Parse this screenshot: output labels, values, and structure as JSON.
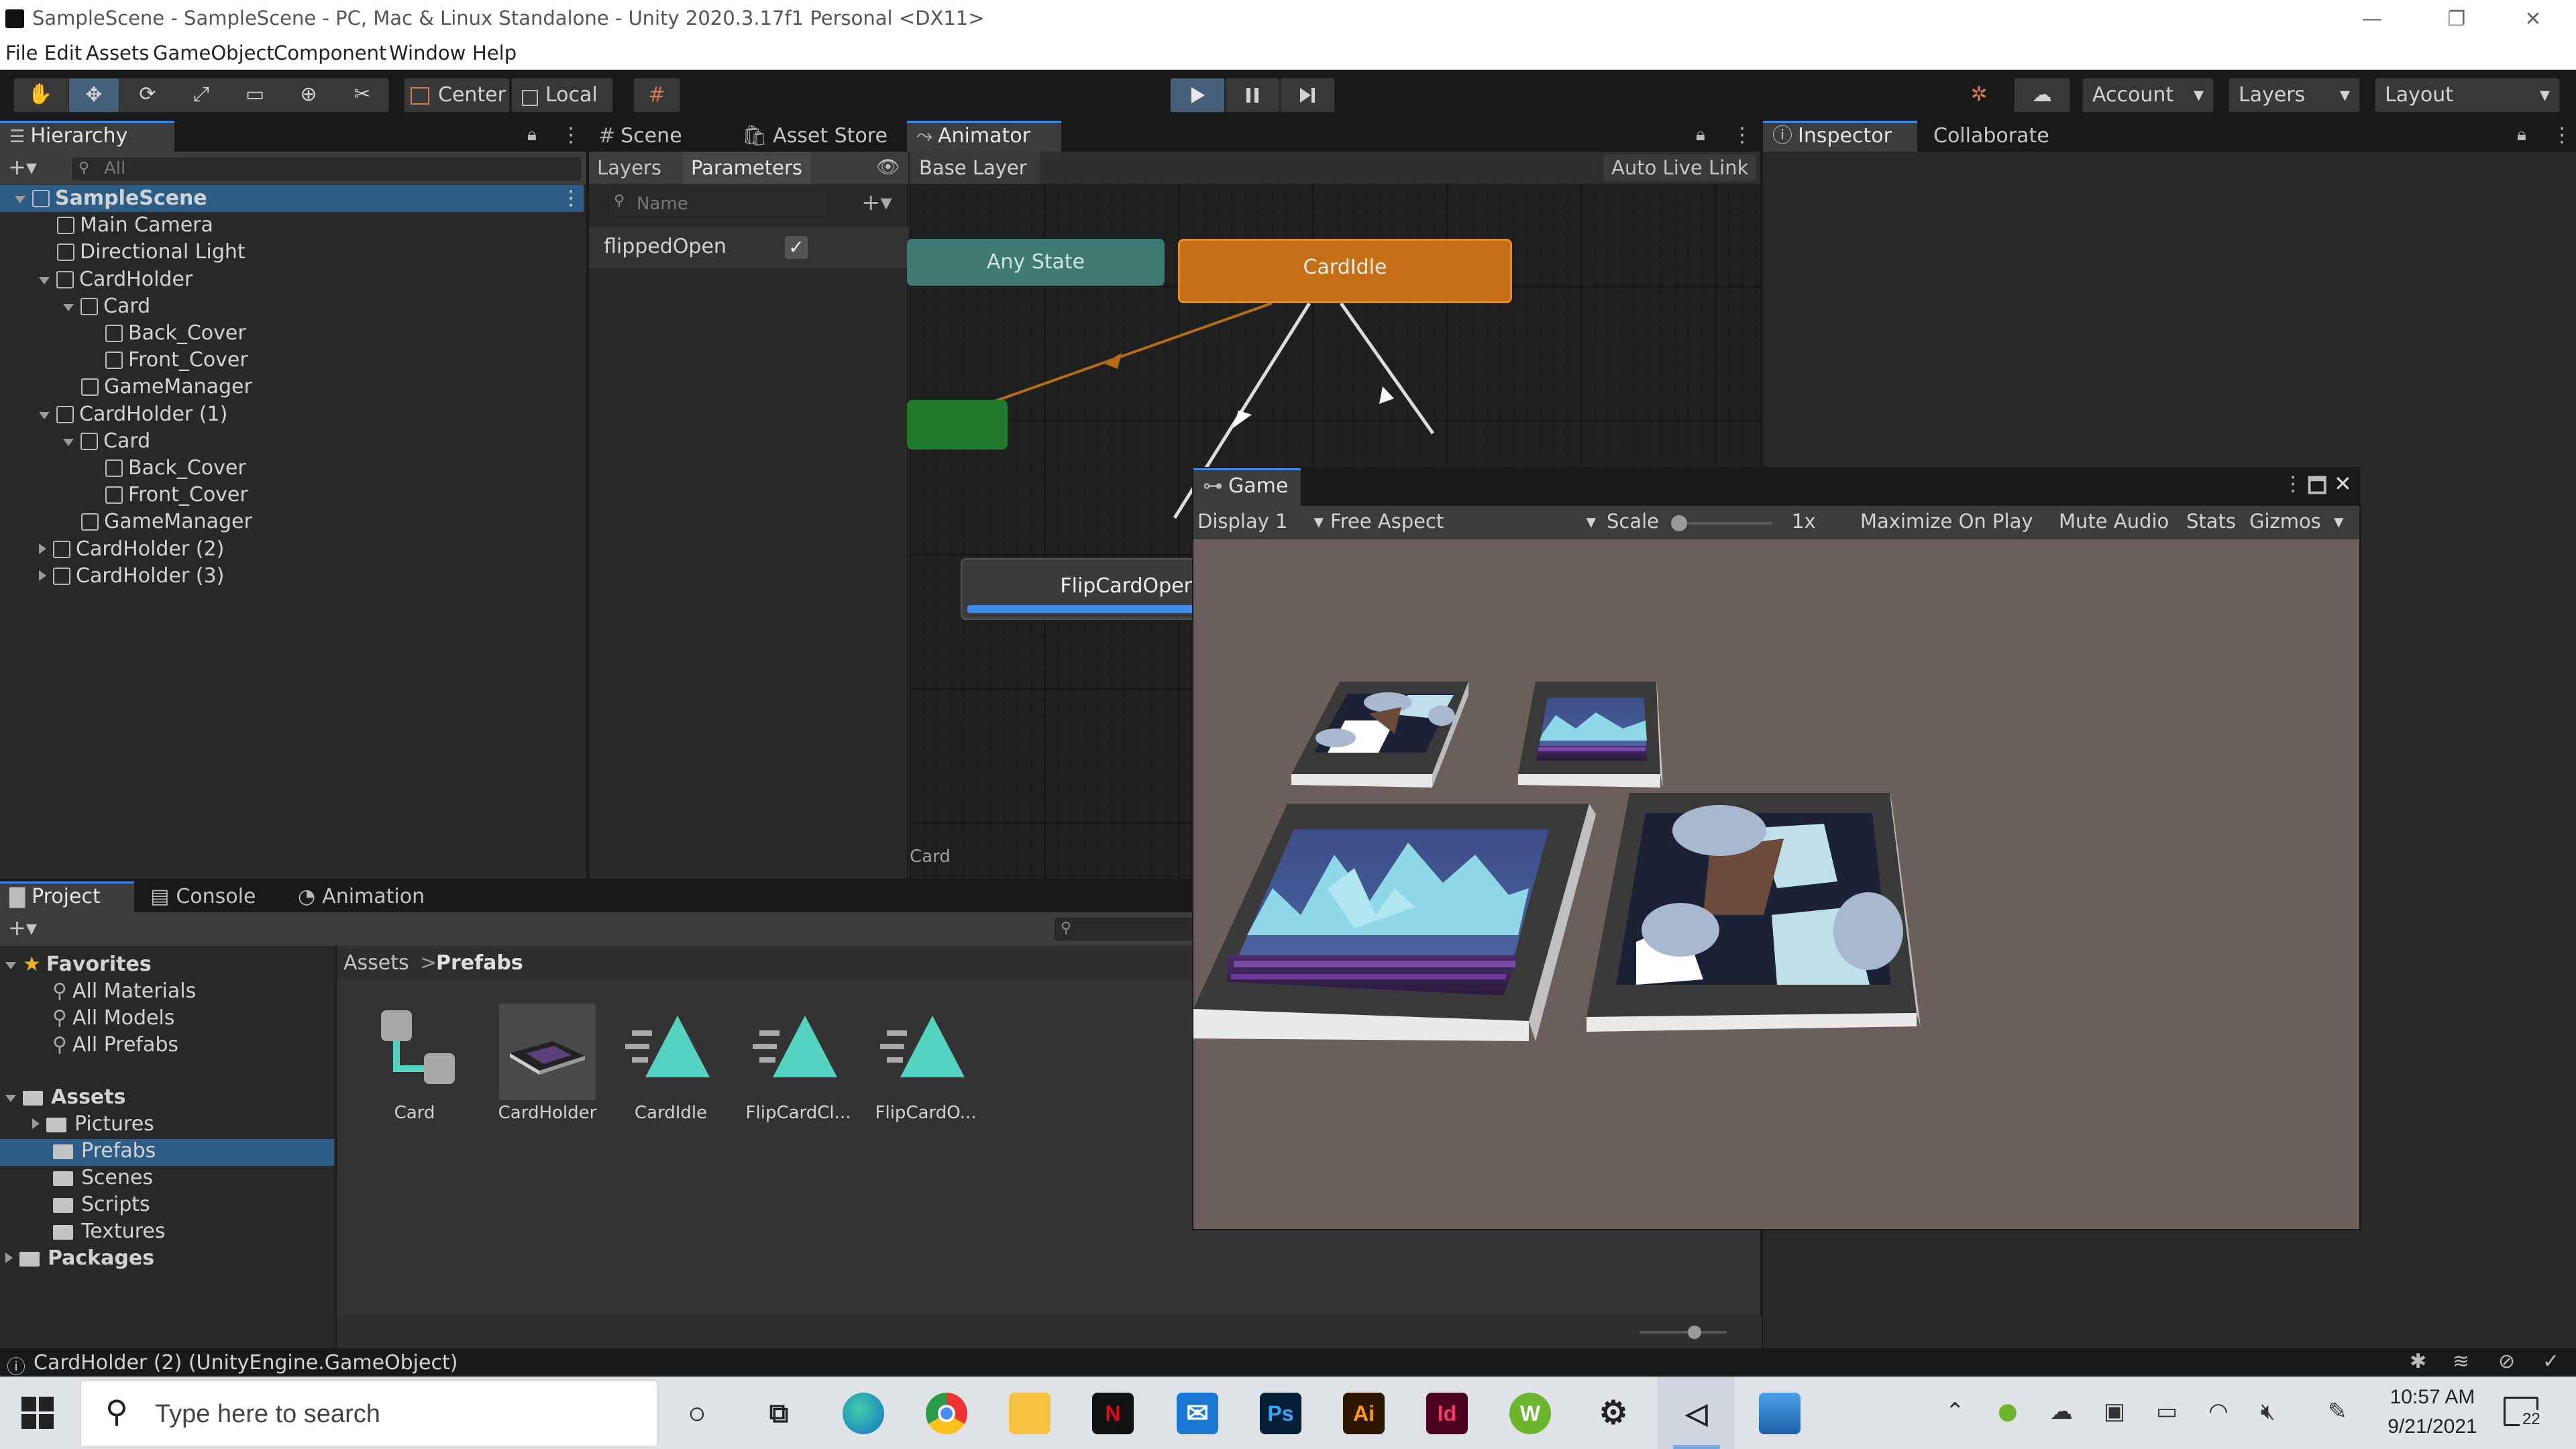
{
  "window": {
    "title": "SampleScene - SampleScene - PC, Mac & Linux Standalone - Unity 2020.3.17f1 Personal <DX11>",
    "minimize": "—",
    "restore": "❐",
    "close": "✕"
  },
  "menu": [
    "File",
    "Edit",
    "Assets",
    "GameObject",
    "Component",
    "Window",
    "Help"
  ],
  "toolbar": {
    "pivot": "Center",
    "space": "Local",
    "account": "Account",
    "layers": "Layers",
    "layout": "Layout",
    "play_icon": "play-icon",
    "pause_icon": "pause-icon",
    "step_icon": "step-icon"
  },
  "hierarchy": {
    "tab": "Hierarchy",
    "search_placeholder": "All",
    "rows": [
      {
        "label": "SampleScene",
        "depth": 0,
        "arrow": "down"
      },
      {
        "label": "Main Camera",
        "depth": 1,
        "arrow": ""
      },
      {
        "label": "Directional Light",
        "depth": 1,
        "arrow": ""
      },
      {
        "label": "CardHolder",
        "depth": 1,
        "arrow": "down"
      },
      {
        "label": "Card",
        "depth": 2,
        "arrow": "down"
      },
      {
        "label": "Back_Cover",
        "depth": 3,
        "arrow": ""
      },
      {
        "label": "Front_Cover",
        "depth": 3,
        "arrow": ""
      },
      {
        "label": "GameManager",
        "depth": 2,
        "arrow": ""
      },
      {
        "label": "CardHolder (1)",
        "depth": 1,
        "arrow": "down"
      },
      {
        "label": "Card",
        "depth": 2,
        "arrow": "down"
      },
      {
        "label": "Back_Cover",
        "depth": 3,
        "arrow": ""
      },
      {
        "label": "Front_Cover",
        "depth": 3,
        "arrow": ""
      },
      {
        "label": "GameManager",
        "depth": 2,
        "arrow": ""
      },
      {
        "label": "CardHolder (2)",
        "depth": 1,
        "arrow": "right"
      },
      {
        "label": "CardHolder (3)",
        "depth": 1,
        "arrow": "right"
      }
    ]
  },
  "center_tabs": {
    "scene": "Scene",
    "asset_store": "Asset Store",
    "animator": "Animator"
  },
  "animator": {
    "layers_tab": "Layers",
    "parameters_tab": "Parameters",
    "base_layer": "Base Layer",
    "auto_live_link": "Auto Live Link",
    "name_placeholder": "Name",
    "parameter_name": "flippedOpen",
    "parameter_checked": true,
    "any_state": "Any State",
    "card_idle": "CardIdle",
    "flip_card_open": "FlipCardOpen",
    "footer": "Card"
  },
  "inspector": {
    "tab": "Inspector",
    "collaborate": "Collaborate"
  },
  "game": {
    "tab": "Game",
    "display": "Display 1",
    "aspect": "Free Aspect",
    "scale_label": "Scale",
    "scale_value": "1x",
    "maximize": "Maximize On Play",
    "mute": "Mute Audio",
    "stats": "Stats",
    "gizmos": "Gizmos"
  },
  "bottom_tabs": {
    "project": "Project",
    "console": "Console",
    "animation": "Animation"
  },
  "project": {
    "favorites": "Favorites",
    "favorite_items": [
      "All Materials",
      "All Models",
      "All Prefabs"
    ],
    "assets": "Assets",
    "asset_folders": [
      "Pictures",
      "Prefabs",
      "Scenes",
      "Scripts",
      "Textures"
    ],
    "packages": "Packages",
    "breadcrumb_root": "Assets",
    "breadcrumb_sep": ">",
    "breadcrumb_current": "Prefabs",
    "items": [
      "Card",
      "CardHolder",
      "CardIdle",
      "FlipCardCl...",
      "FlipCardO..."
    ]
  },
  "status": {
    "message": "CardHolder (2) (UnityEngine.GameObject)"
  },
  "taskbar": {
    "search_placeholder": "Type here to search",
    "time": "10:57 AM",
    "date": "9/21/2021",
    "notifications": "22",
    "apps": [
      "cortana",
      "task-view",
      "edge",
      "chrome",
      "file-explorer",
      "netflix",
      "mail",
      "photoshop",
      "illustrator",
      "indesign",
      "webroot",
      "settings",
      "unity",
      "photos"
    ],
    "ps_label": "Ps",
    "ai_label": "Ai",
    "id_label": "Id",
    "w_label": "W",
    "n_label": "N"
  },
  "colors": {
    "selection": "#2c5d87",
    "accent": "#3c8ce7",
    "any_state": "#3d7a72",
    "card_idle": "#c56e16",
    "entry_green": "#1f7a2c",
    "game_bg": "#6b5f5b"
  }
}
